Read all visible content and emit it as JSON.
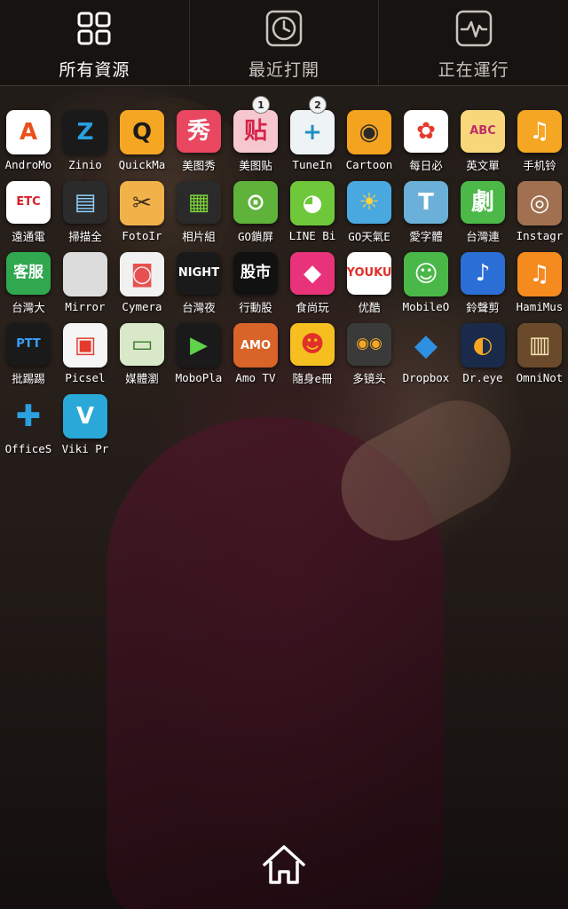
{
  "tabs": [
    {
      "label": "所有資源",
      "icon": "grid-icon",
      "active": true
    },
    {
      "label": "最近打開",
      "icon": "clock-icon",
      "active": false
    },
    {
      "label": "正在運行",
      "icon": "pulse-icon",
      "active": false
    }
  ],
  "apps": [
    [
      {
        "label": "AndroMo",
        "glyph": "A",
        "icon": "andromo-icon",
        "bg": "#ffffff",
        "fg": "#e8501c"
      },
      {
        "label": "Zinio",
        "glyph": "Z",
        "icon": "zinio-icon",
        "bg": "#1a1a1a",
        "fg": "#2aa0e0"
      },
      {
        "label": "QuickMa",
        "glyph": "Q",
        "icon": "quickmark-icon",
        "bg": "#f5a623",
        "fg": "#1a1a1a"
      },
      {
        "label": "美图秀",
        "glyph": "秀",
        "icon": "meitu-icon",
        "bg": "#e8475f",
        "fg": "#ffffff"
      },
      {
        "label": "美图贴",
        "glyph": "贴",
        "icon": "meitu-tie-icon",
        "bg": "#f7c7cf",
        "fg": "#d6234a",
        "badge": "1"
      },
      {
        "label": "TuneIn",
        "glyph": "+",
        "icon": "tunein-icon",
        "bg": "#eef3f5",
        "fg": "#1f8fc0",
        "badge": "2"
      },
      {
        "label": "Cartoon",
        "glyph": "◉",
        "icon": "camera-cartoon-icon",
        "bg": "#f3a31e",
        "fg": "#2a2a2a"
      },
      {
        "label": "每日必",
        "glyph": "✿",
        "icon": "flower-icon",
        "bg": "#ffffff",
        "fg": "#e53b2f"
      },
      {
        "label": "英文單",
        "glyph": "ABC",
        "icon": "english-words-icon",
        "bg": "#f7d77a",
        "fg": "#c02c6b"
      },
      {
        "label": "手机铃",
        "glyph": "♫",
        "icon": "ringtone-icon",
        "bg": "#f5a623",
        "fg": "#ffffff"
      }
    ],
    [
      {
        "label": "遠通電",
        "glyph": "ETC",
        "icon": "etc-icon",
        "bg": "#ffffff",
        "fg": "#d6202a"
      },
      {
        "label": "掃描全",
        "glyph": "▤",
        "icon": "scanner-icon",
        "bg": "#2b2b2b",
        "fg": "#8fd0ff"
      },
      {
        "label": "FotoIr",
        "glyph": "✂",
        "icon": "fotoir-icon",
        "bg": "#f2b24a",
        "fg": "#3a2a1a"
      },
      {
        "label": "相片組",
        "glyph": "▦",
        "icon": "photo-grid-icon",
        "bg": "#2a2a2a",
        "fg": "#7bd13a"
      },
      {
        "label": "GO鎖屏",
        "glyph": "⊙",
        "icon": "go-locker-icon",
        "bg": "#5fb23a",
        "fg": "#ffffff"
      },
      {
        "label": "LINE Bi",
        "glyph": "◕",
        "icon": "line-bird-icon",
        "bg": "#6fc83a",
        "fg": "#ffffff"
      },
      {
        "label": "GO天氣E",
        "glyph": "☀",
        "icon": "go-weather-icon",
        "bg": "#4aa8e0",
        "fg": "#ffd23a"
      },
      {
        "label": "愛字體",
        "glyph": "T",
        "icon": "font-icon",
        "bg": "#6ab0d8",
        "fg": "#ffffff"
      },
      {
        "label": "台灣連",
        "glyph": "劇",
        "icon": "tw-drama-icon",
        "bg": "#4cb847",
        "fg": "#ffffff"
      },
      {
        "label": "Instagr",
        "glyph": "◎",
        "icon": "instagram-icon",
        "bg": "#a07050",
        "fg": "#ffffff"
      }
    ],
    [
      {
        "label": "台灣大",
        "glyph": "客服",
        "icon": "twm-service-icon",
        "bg": "#2fa84f",
        "fg": "#ffffff"
      },
      {
        "label": "Mirror",
        "glyph": "",
        "icon": "mirror-icon",
        "bg": "#dcdcdc",
        "fg": "#333333"
      },
      {
        "label": "Cymera",
        "glyph": "◙",
        "icon": "cymera-icon",
        "bg": "#f1f1f1",
        "fg": "#e85050"
      },
      {
        "label": "台灣夜",
        "glyph": "NIGHT",
        "icon": "night-market-icon",
        "bg": "#1a1a1a",
        "fg": "#ffffff"
      },
      {
        "label": "行動股",
        "glyph": "股市",
        "icon": "stock-icon",
        "bg": "#111111",
        "fg": "#ffffff"
      },
      {
        "label": "食尚玩",
        "glyph": "◆",
        "icon": "food-travel-icon",
        "bg": "#e8337a",
        "fg": "#ffffff"
      },
      {
        "label": "优酷",
        "glyph": "YOUKU",
        "icon": "youku-icon",
        "bg": "#ffffff",
        "fg": "#e0302a"
      },
      {
        "label": "MobileO",
        "glyph": "☺",
        "icon": "mobileo-icon",
        "bg": "#4ab848",
        "fg": "#ffffff"
      },
      {
        "label": "鈴聲剪",
        "glyph": "♪",
        "icon": "ringtone-cut-icon",
        "bg": "#2b6fd6",
        "fg": "#ffffff"
      },
      {
        "label": "HamiMus",
        "glyph": "♫",
        "icon": "hami-music-icon",
        "bg": "#f58a1f",
        "fg": "#ffffff"
      }
    ],
    [
      {
        "label": "批踢踢",
        "glyph": "PTT",
        "icon": "ptt-icon",
        "bg": "#1a1a1a",
        "fg": "#3aa0ff"
      },
      {
        "label": "Picsel",
        "glyph": "▣",
        "icon": "picsel-icon",
        "bg": "#f5f5f5",
        "fg": "#e53b2f"
      },
      {
        "label": "媒體瀏",
        "glyph": "▭",
        "icon": "media-browser-icon",
        "bg": "#d8e8c8",
        "fg": "#3a7a2a"
      },
      {
        "label": "MoboPla",
        "glyph": "▶",
        "icon": "moboplayer-icon",
        "bg": "#1a1a1a",
        "fg": "#5fd14a"
      },
      {
        "label": "Amo TV",
        "glyph": "AMO",
        "icon": "amo-tv-icon",
        "bg": "#d8642a",
        "fg": "#ffffff"
      },
      {
        "label": "隨身e冊",
        "glyph": "☻",
        "icon": "ebook-icon",
        "bg": "#f5c01f",
        "fg": "#e0302a"
      },
      {
        "label": "多镜头",
        "glyph": "◉◉",
        "icon": "multi-lens-icon",
        "bg": "#3a3a3a",
        "fg": "#f5a623"
      },
      {
        "label": "Dropbox",
        "glyph": "◆",
        "icon": "dropbox-icon",
        "bg": "rgba(0,0,0,0)",
        "fg": "#2f8fe0"
      },
      {
        "label": "Dr.eye",
        "glyph": "◐",
        "icon": "dreye-icon",
        "bg": "#1a2a4a",
        "fg": "#f5a623"
      },
      {
        "label": "OmniNot",
        "glyph": "▥",
        "icon": "omninote-icon",
        "bg": "#6a4a2a",
        "fg": "#f5e0b0"
      }
    ],
    [
      {
        "label": "OfficeS",
        "glyph": "✚",
        "icon": "officesuite-icon",
        "bg": "rgba(0,0,0,0)",
        "fg": "#2aa0e0"
      },
      {
        "label": "Viki Pr",
        "glyph": "V",
        "icon": "viki-icon",
        "bg": "#2aa8d8",
        "fg": "#ffffff"
      }
    ]
  ],
  "home": {
    "icon": "home-icon"
  }
}
